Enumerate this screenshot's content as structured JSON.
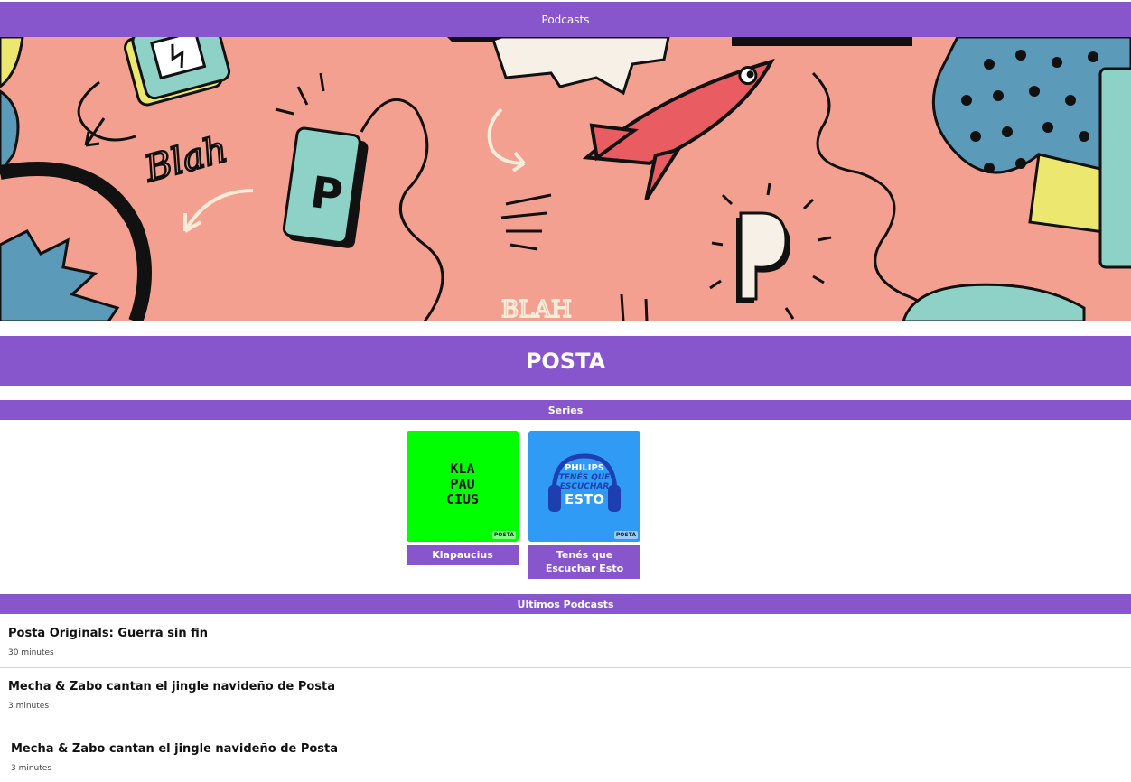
{
  "header": {
    "title": "Podcasts"
  },
  "hero": {
    "alt_words": [
      "Blah",
      "BLAH"
    ],
    "badge_letter": "P"
  },
  "brand": {
    "name": "POSTA"
  },
  "series_section": {
    "title": "Series",
    "items": [
      {
        "label": "Klapaucius",
        "cover_text": [
          "KLA",
          "PAU",
          "CIUS"
        ],
        "cover_color": "#00ff00"
      },
      {
        "label": "Tenés que Escuchar Esto",
        "cover_text": [
          "PHILIPS",
          "TENÉS QUE",
          "ESCUCHAR",
          "ESTO"
        ],
        "cover_color": "#2f9bf5"
      }
    ],
    "cover_badge": "POSTA"
  },
  "latest_section": {
    "title": "Ultimos Podcasts",
    "episodes": [
      {
        "title": "Posta Originals: Guerra sin fin",
        "duration": "30 minutes"
      },
      {
        "title": "Mecha & Zabo cantan el jingle navideño de Posta",
        "duration": "3 minutes"
      },
      {
        "title": "Mecha & Zabo cantan el jingle navideño de Posta",
        "duration": "3 minutes"
      }
    ]
  },
  "colors": {
    "accent": "#8856cc",
    "hero_bg": "#f4a091",
    "text": "#111111"
  }
}
